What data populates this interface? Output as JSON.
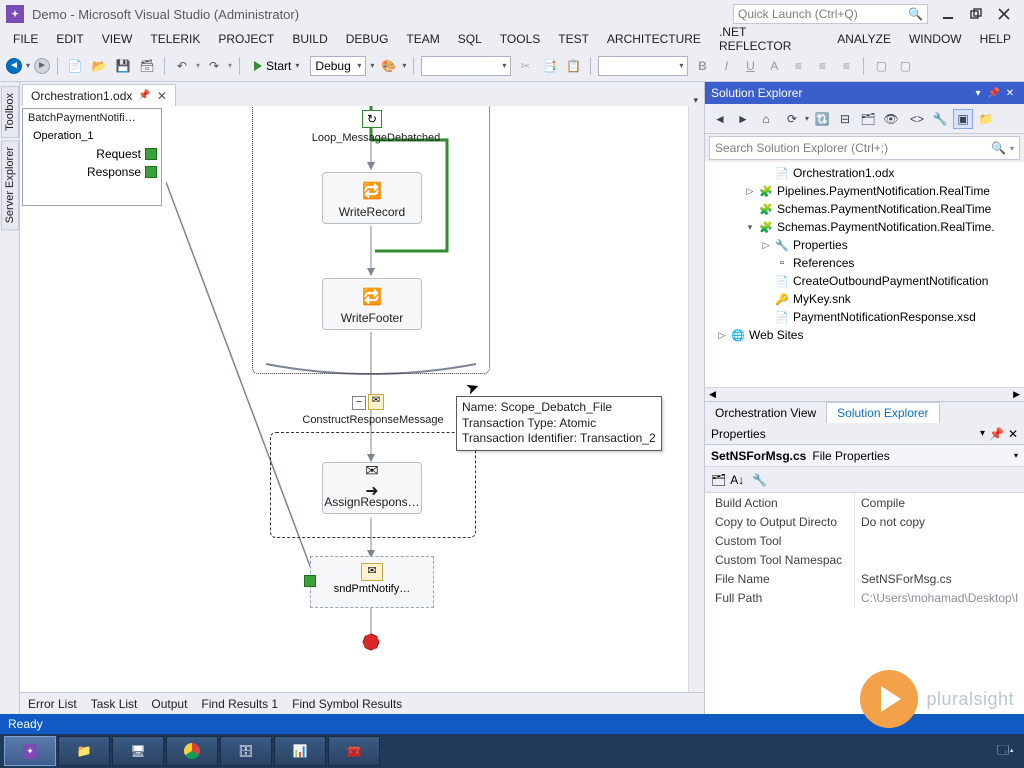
{
  "title": "Demo - Microsoft Visual Studio (Administrator)",
  "quick_launch_placeholder": "Quick Launch (Ctrl+Q)",
  "menu": [
    "FILE",
    "EDIT",
    "VIEW",
    "TELERIK",
    "PROJECT",
    "BUILD",
    "DEBUG",
    "TEAM",
    "SQL",
    "TOOLS",
    "TEST",
    "ARCHITECTURE",
    ".NET REFLECTOR",
    "ANALYZE",
    "WINDOW",
    "HELP"
  ],
  "toolbar": {
    "start_label": "Start",
    "config": "Debug"
  },
  "left_tabs": [
    "Toolbox",
    "Server Explorer"
  ],
  "doc_tab": {
    "name": "Orchestration1.odx"
  },
  "port_panel": {
    "title": "BatchPaymentNotifi…",
    "operation": "Operation_1",
    "rows": [
      "Request",
      "Response"
    ]
  },
  "orchestration": {
    "loop_label": "Loop_MessageDebatched",
    "write_record": "WriteRecord",
    "write_footer": "WriteFooter",
    "construct_label": "ConstructResponseMessage",
    "assign": "AssignRespons…",
    "send": "sndPmtNotify…"
  },
  "tooltip": {
    "l1": "Name: Scope_Debatch_File",
    "l2": "Transaction Type: Atomic",
    "l3": "Transaction Identifier: Transaction_2"
  },
  "orch_tab": "Orchestration",
  "bottom_tabs": [
    "Error List",
    "Task List",
    "Output",
    "Find Results 1",
    "Find Symbol Results"
  ],
  "solution_explorer": {
    "title": "Solution Explorer",
    "search_placeholder": "Search Solution Explorer (Ctrl+;)",
    "nodes": [
      {
        "indent": 56,
        "exp": "",
        "icon": "📄",
        "label": "Orchestration1.odx"
      },
      {
        "indent": 40,
        "exp": "▷",
        "icon": "🧩",
        "label": "Pipelines.PaymentNotification.RealTime"
      },
      {
        "indent": 40,
        "exp": "",
        "icon": "🧩",
        "label": "Schemas.PaymentNotification.RealTime"
      },
      {
        "indent": 40,
        "exp": "▾",
        "icon": "🧩",
        "label": "Schemas.PaymentNotification.RealTime."
      },
      {
        "indent": 56,
        "exp": "▷",
        "icon": "🔧",
        "label": "Properties"
      },
      {
        "indent": 56,
        "exp": "",
        "icon": "▫",
        "label": "References"
      },
      {
        "indent": 56,
        "exp": "",
        "icon": "📄",
        "label": "CreateOutboundPaymentNotification"
      },
      {
        "indent": 56,
        "exp": "",
        "icon": "🔑",
        "label": "MyKey.snk"
      },
      {
        "indent": 56,
        "exp": "",
        "icon": "📄",
        "label": "PaymentNotificationResponse.xsd"
      },
      {
        "indent": 12,
        "exp": "▷",
        "icon": "🌐",
        "label": "Web Sites"
      }
    ],
    "view_tabs": [
      "Orchestration View",
      "Solution Explorer"
    ]
  },
  "properties": {
    "title": "Properties",
    "subject_name": "SetNSForMsg.cs",
    "subject_type": "File Properties",
    "rows": [
      {
        "k": "Build Action",
        "v": "Compile"
      },
      {
        "k": "Copy to Output Directo",
        "v": "Do not copy"
      },
      {
        "k": "Custom Tool",
        "v": ""
      },
      {
        "k": "Custom Tool Namespac",
        "v": ""
      },
      {
        "k": "File Name",
        "v": "SetNSForMsg.cs"
      },
      {
        "k": "Full Path",
        "v": "C:\\Users\\mohamad\\Desktop\\I",
        "dim": true
      }
    ]
  },
  "status": "Ready",
  "brand": "pluralsight"
}
